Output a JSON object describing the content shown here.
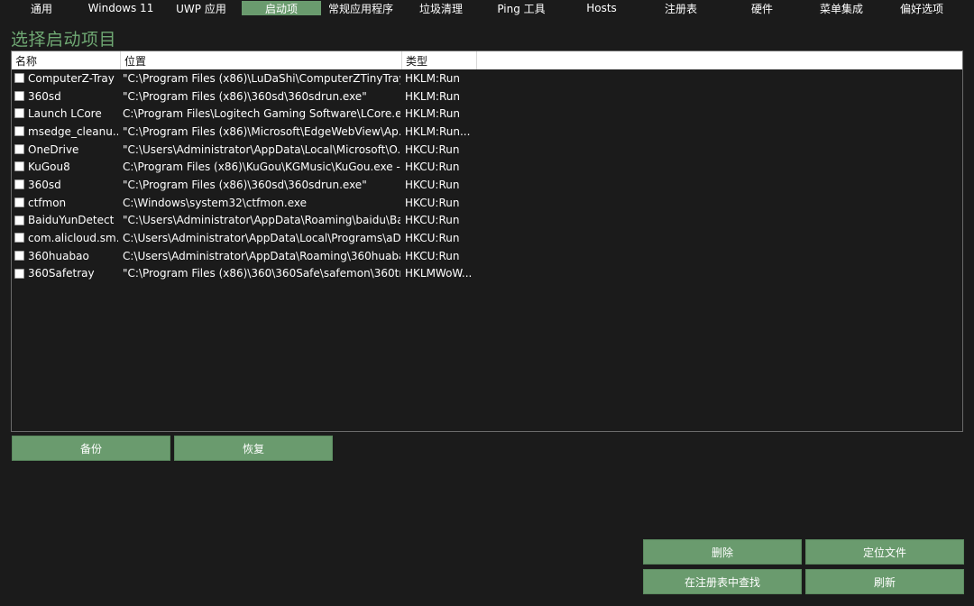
{
  "tabs": [
    {
      "label": "通用"
    },
    {
      "label": "Windows 11"
    },
    {
      "label": "UWP 应用"
    },
    {
      "label": "启动项"
    },
    {
      "label": "常规应用程序"
    },
    {
      "label": "垃圾清理"
    },
    {
      "label": "Ping 工具"
    },
    {
      "label": "Hosts"
    },
    {
      "label": "注册表"
    },
    {
      "label": "硬件"
    },
    {
      "label": "菜单集成"
    },
    {
      "label": "偏好选项"
    }
  ],
  "active_tab": "启动项",
  "page": {
    "title": "选择启动项目"
  },
  "table": {
    "columns": [
      "名称",
      "位置",
      "类型"
    ],
    "rows": [
      {
        "name": "ComputerZ-Tray",
        "location": "\"C:\\Program Files (x86)\\LuDaShi\\ComputerZTinyTray...",
        "type": "HKLM:Run"
      },
      {
        "name": "360sd",
        "location": "\"C:\\Program Files (x86)\\360sd\\360sdrun.exe\"",
        "type": "HKLM:Run"
      },
      {
        "name": "Launch LCore",
        "location": "C:\\Program Files\\Logitech Gaming Software\\LCore.e...",
        "type": "HKLM:Run"
      },
      {
        "name": "msedge_cleanu...",
        "location": "\"C:\\Program Files (x86)\\Microsoft\\EdgeWebView\\Ap...",
        "type": "HKLM:Run..."
      },
      {
        "name": "OneDrive",
        "location": "\"C:\\Users\\Administrator\\AppData\\Local\\Microsoft\\O...",
        "type": "HKCU:Run"
      },
      {
        "name": "KuGou8",
        "location": "C:\\Program Files (x86)\\KuGou\\KGMusic\\KuGou.exe -...",
        "type": "HKCU:Run"
      },
      {
        "name": "360sd",
        "location": "\"C:\\Program Files (x86)\\360sd\\360sdrun.exe\"",
        "type": "HKCU:Run"
      },
      {
        "name": "ctfmon",
        "location": "C:\\Windows\\system32\\ctfmon.exe",
        "type": "HKCU:Run"
      },
      {
        "name": "BaiduYunDetect",
        "location": "\"C:\\Users\\Administrator\\AppData\\Roaming\\baidu\\Ba...",
        "type": "HKCU:Run"
      },
      {
        "name": "com.alicloud.sm...",
        "location": "C:\\Users\\Administrator\\AppData\\Local\\Programs\\aD...",
        "type": "HKCU:Run"
      },
      {
        "name": "360huabao",
        "location": "C:\\Users\\Administrator\\AppData\\Roaming\\360huaba...",
        "type": "HKCU:Run"
      },
      {
        "name": "360Safetray",
        "location": "\"C:\\Program Files (x86)\\360\\360Safe\\safemon\\360tr...",
        "type": "HKLMWoW..."
      }
    ]
  },
  "buttons": {
    "backup": "备份",
    "restore": "恢复",
    "delete": "删除",
    "locate_file": "定位文件",
    "find_in_registry": "在注册表中查找",
    "refresh": "刷新"
  },
  "colors": {
    "accent": "#6a9b6e",
    "title_green": "#6fa873",
    "background": "#1b1b1b"
  }
}
